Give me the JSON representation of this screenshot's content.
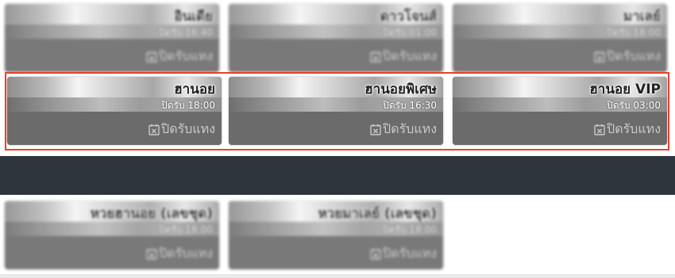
{
  "top_row": [
    {
      "name": "อินเดีย",
      "close": "ปิดรับ 16:40",
      "action": "ปิดรับแทง"
    },
    {
      "name": "ดาวโจนส์",
      "close": "ปิดรับ 01:00",
      "action": "ปิดรับแทง"
    },
    {
      "name": "มาเลย์",
      "close": "ปิดรับ 18:00",
      "action": "ปิดรับแทง"
    }
  ],
  "highlighted_row": [
    {
      "name": "ฮานอย",
      "close": "ปิดรับ 18:00",
      "action": "ปิดรับแทง"
    },
    {
      "name": "ฮานอยพิเศษ",
      "close": "ปิดรับ 16:30",
      "action": "ปิดรับแทง"
    },
    {
      "name": "ฮานอย VIP",
      "close": "ปิดรับ 03:00",
      "action": "ปิดรับแทง"
    }
  ],
  "bottom_row": [
    {
      "name": "หวยฮานอย (เลขชุด)",
      "close": "ปิดรับ 18:00",
      "action": "ปิดรับแทง"
    },
    {
      "name": "หวยมาเลย์ (เลขชุด)",
      "close": "ปิดรับ 18:00",
      "action": "ปิดรับแทง"
    }
  ],
  "icons": {
    "action_icon": "calendar-x-icon"
  },
  "colors": {
    "highlight_border": "#e8412c",
    "dark_band": "#2e343c"
  }
}
